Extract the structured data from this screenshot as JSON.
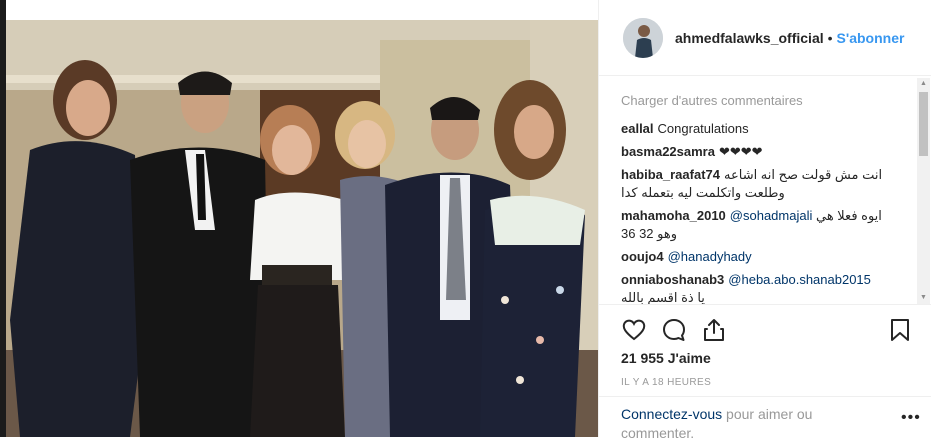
{
  "header": {
    "username": "ahmedfalawks_official",
    "separator": "•",
    "follow_label": "S'abonner"
  },
  "comments": {
    "load_more_label": "Charger d'autres commentaires",
    "items": [
      {
        "user": "eallal",
        "text": "Congratulations"
      },
      {
        "user": "basma22samra",
        "text": "❤❤❤❤"
      },
      {
        "user": "habiba_raafat74",
        "text": "انت مش قولت صح انه اشاعه",
        "text2": "وطلعت واتكلمت ليه بتعمله كدا"
      },
      {
        "user": "mahamoha_2010",
        "mention": "@sohadmajali",
        "text": "ايوه فعلا هي",
        "text2": "36 وهو 32"
      },
      {
        "user": "ooujo4",
        "mention": "@hanadyhady",
        "text": ""
      },
      {
        "user": "onniaboshanab3",
        "mention": "@heba.abo.shanab2015",
        "text": "يا ذة اقسم بالله"
      }
    ]
  },
  "actions": {
    "like_icon": "heart-icon",
    "comment_icon": "comment-icon",
    "share_icon": "share-icon",
    "save_icon": "bookmark-icon"
  },
  "likes_label": "21 955 J'aime",
  "time_label": "IL Y A 18 HEURES",
  "footer": {
    "login_link": "Connectez-vous",
    "login_text": " pour aimer ou commenter.",
    "more_label": "•••"
  },
  "colors": {
    "accent": "#3897f0",
    "link": "#003569",
    "muted": "#999999",
    "text": "#262626"
  }
}
